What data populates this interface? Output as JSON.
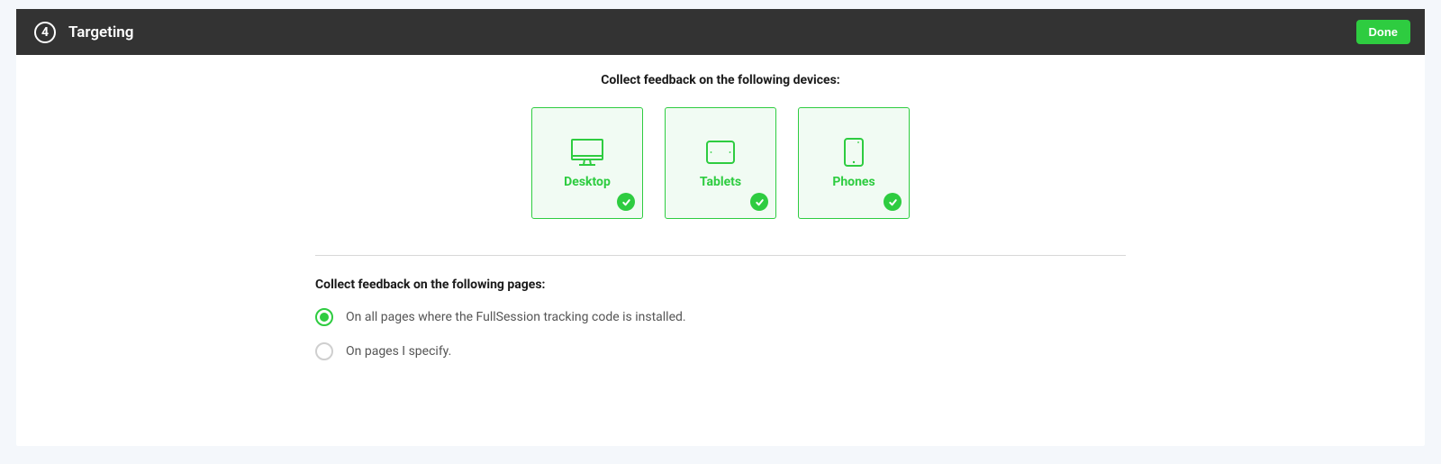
{
  "header": {
    "step_number": "4",
    "title": "Targeting",
    "done_label": "Done"
  },
  "devices": {
    "heading": "Collect feedback on the following devices:",
    "items": [
      {
        "label": "Desktop",
        "selected": true
      },
      {
        "label": "Tablets",
        "selected": true
      },
      {
        "label": "Phones",
        "selected": true
      }
    ]
  },
  "pages": {
    "heading": "Collect feedback on the following pages:",
    "options": [
      {
        "label": "On all pages where the FullSession tracking code is installed.",
        "selected": true
      },
      {
        "label": "On pages I specify.",
        "selected": false
      }
    ]
  },
  "colors": {
    "accent": "#2ecc40",
    "header_bg": "#333333"
  }
}
